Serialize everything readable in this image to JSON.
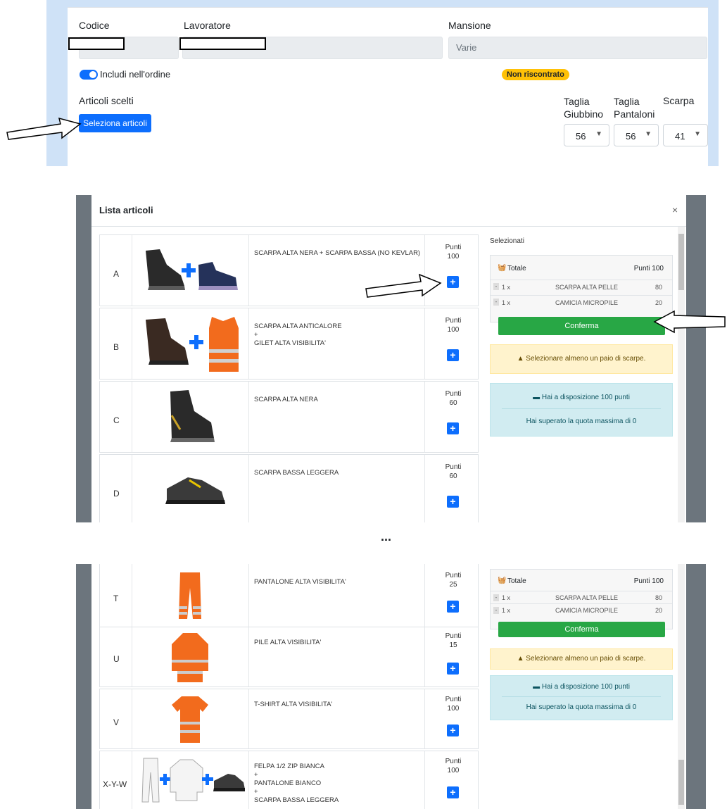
{
  "form": {
    "code_label": "Codice",
    "worker_label": "Lavoratore",
    "role_label": "Mansione",
    "role_value": "Varie",
    "include_label": "Includi nell'ordine",
    "status_badge": "Non riscontrato",
    "chosen_label": "Articoli scelti",
    "select_button": "Seleziona articoli",
    "size_jacket_label_1": "Taglia",
    "size_jacket_label_2": "Giubbino",
    "size_pants_label_1": "Taglia",
    "size_pants_label_2": "Pantaloni",
    "shoe_label": "Scarpa",
    "size_jacket_value": "56",
    "size_pants_value": "56",
    "shoe_value": "41"
  },
  "modal": {
    "title": "Lista articoli",
    "close": "×",
    "selected_label": "Selezionati",
    "total_label": "Totale",
    "total_points": "Punti 100",
    "selected_items": [
      {
        "qty": "1 x",
        "name": "SCARPA ALTA PELLE",
        "points": "80"
      },
      {
        "qty": "1 x",
        "name": "CAMICIA MICROPILE",
        "points": "20"
      }
    ],
    "confirm_button": "Conferma",
    "warning_text": "Selezionare almeno un paio di scarpe.",
    "available_text": "Hai a disposizione 100 punti",
    "exceeded_text": "Hai superato la quota massima di 0",
    "points_word": "Punti",
    "remove_symbol": "-",
    "plus_symbol": "+"
  },
  "articles_top": [
    {
      "letter": "A",
      "desc": [
        "SCARPA ALTA NERA + SCARPA BASSA (NO KEVLAR)"
      ],
      "points": "100"
    },
    {
      "letter": "B",
      "desc": [
        "SCARPA ALTA ANTICALORE",
        "+",
        "GILET ALTA VISIBILITA'"
      ],
      "points": "100"
    },
    {
      "letter": "C",
      "desc": [
        "SCARPA ALTA NERA"
      ],
      "points": "60"
    },
    {
      "letter": "D",
      "desc": [
        "SCARPA BASSA LEGGERA"
      ],
      "points": "60"
    }
  ],
  "articles_bottom": [
    {
      "letter": "T",
      "desc": [
        "PANTALONE ALTA VISIBILITA'"
      ],
      "points": "25"
    },
    {
      "letter": "U",
      "desc": [
        "PILE ALTA VISIBILITA'"
      ],
      "points": "15"
    },
    {
      "letter": "V",
      "desc": [
        "T-SHIRT ALTA VISIBILITA'"
      ],
      "points": "100"
    },
    {
      "letter": "X-Y-W",
      "desc": [
        "FELPA 1/2 ZIP BIANCA",
        "+",
        "PANTALONE BIANCO",
        "+",
        "SCARPA BASSA LEGGERA"
      ],
      "points": "100"
    }
  ],
  "ellipsis": "...",
  "colors": {
    "primary": "#0d6efd",
    "success": "#28a745",
    "warning": "#ffc107",
    "hi_vis_orange": "#f26b1d",
    "overlay": "#6c757d"
  }
}
